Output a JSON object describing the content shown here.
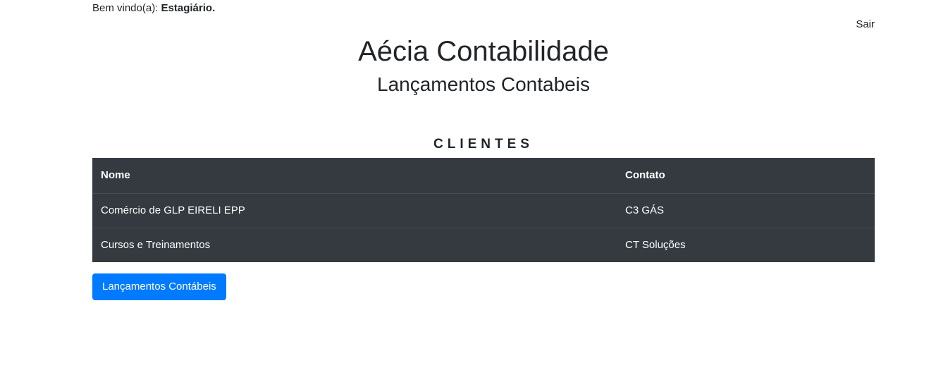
{
  "header": {
    "welcome_prefix": "Bem vindo(a): ",
    "user_name": "Estagiário.",
    "logout_label": "Sair"
  },
  "main": {
    "company_title": "Aécia Contabilidade",
    "page_subtitle": "Lançamentos Contabeis",
    "section_title": "CLIENTES"
  },
  "table": {
    "headers": [
      "Nome",
      "Contato"
    ],
    "rows": [
      {
        "nome": "Comércio de GLP EIRELI EPP",
        "contato": "C3 GÁS"
      },
      {
        "nome": "Cursos e Treinamentos",
        "contato": "CT Soluções"
      }
    ]
  },
  "actions": {
    "lancamentos_button_label": "Lançamentos Contábeis"
  },
  "colors": {
    "table_background": "#343a40",
    "table_border": "#454d55",
    "primary_button": "#007bff",
    "text": "#212529"
  }
}
